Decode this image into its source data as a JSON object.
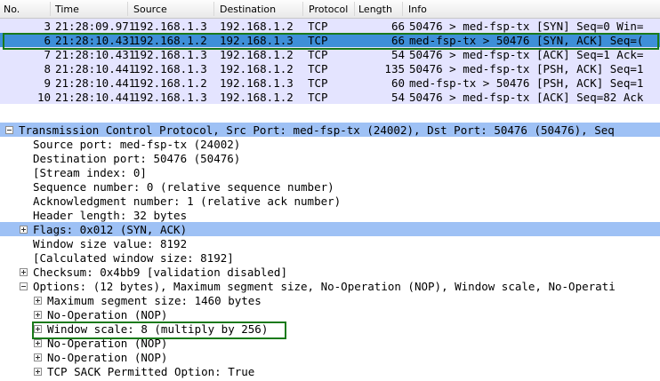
{
  "packet_list": {
    "columns": [
      "No.",
      "Time",
      "Source",
      "Destination",
      "Protocol",
      "Length",
      "Info"
    ],
    "rows": [
      {
        "no": "3",
        "time": "21:28:09.971",
        "src": "192.168.1.3",
        "dst": "192.168.1.2",
        "proto": "TCP",
        "len": "66",
        "info": "50476 > med-fsp-tx [SYN] Seq=0 Win=",
        "selected": false
      },
      {
        "no": "6",
        "time": "21:28:10.431",
        "src": "192.168.1.2",
        "dst": "192.168.1.3",
        "proto": "TCP",
        "len": "66",
        "info": "med-fsp-tx > 50476 [SYN, ACK] Seq=(",
        "selected": true
      },
      {
        "no": "7",
        "time": "21:28:10.431",
        "src": "192.168.1.3",
        "dst": "192.168.1.2",
        "proto": "TCP",
        "len": "54",
        "info": "50476 > med-fsp-tx [ACK] Seq=1 Ack=",
        "selected": false
      },
      {
        "no": "8",
        "time": "21:28:10.441",
        "src": "192.168.1.3",
        "dst": "192.168.1.2",
        "proto": "TCP",
        "len": "135",
        "info": "50476 > med-fsp-tx [PSH, ACK] Seq=1",
        "selected": false
      },
      {
        "no": "9",
        "time": "21:28:10.441",
        "src": "192.168.1.2",
        "dst": "192.168.1.3",
        "proto": "TCP",
        "len": "60",
        "info": "med-fsp-tx > 50476 [PSH, ACK] Seq=1",
        "selected": false
      },
      {
        "no": "10",
        "time": "21:28:10.441",
        "src": "192.168.1.3",
        "dst": "192.168.1.2",
        "proto": "TCP",
        "len": "54",
        "info": "50476 > med-fsp-tx [ACK] Seq=82 Ack",
        "selected": false
      }
    ]
  },
  "details": {
    "rows": [
      {
        "text": "Transmission Control Protocol, Src Port: med-fsp-tx (24002), Dst Port: 50476 (50476), Seq",
        "indent": 0,
        "expander": "minus",
        "band": true,
        "name": "tcp-header-node"
      },
      {
        "text": "Source port: med-fsp-tx (24002)",
        "indent": 1,
        "expander": "none",
        "band": false,
        "name": "source-port-field"
      },
      {
        "text": "Destination port: 50476 (50476)",
        "indent": 1,
        "expander": "none",
        "band": false,
        "name": "destination-port-field"
      },
      {
        "text": "[Stream index: 0]",
        "indent": 1,
        "expander": "none",
        "band": false,
        "name": "stream-index-field"
      },
      {
        "text": "Sequence number: 0    (relative sequence number)",
        "indent": 1,
        "expander": "none",
        "band": false,
        "name": "sequence-number-field"
      },
      {
        "text": "Acknowledgment number: 1    (relative ack number)",
        "indent": 1,
        "expander": "none",
        "band": false,
        "name": "ack-number-field"
      },
      {
        "text": "Header length: 32 bytes",
        "indent": 1,
        "expander": "none",
        "band": false,
        "name": "header-length-field"
      },
      {
        "text": "Flags: 0x012 (SYN, ACK)",
        "indent": 1,
        "expander": "plus",
        "band": true,
        "name": "flags-node"
      },
      {
        "text": "Window size value: 8192",
        "indent": 1,
        "expander": "none",
        "band": false,
        "name": "window-size-value-field"
      },
      {
        "text": "[Calculated window size: 8192]",
        "indent": 1,
        "expander": "none",
        "band": false,
        "name": "calculated-window-size-field"
      },
      {
        "text": "Checksum: 0x4bb9 [validation disabled]",
        "indent": 1,
        "expander": "plus",
        "band": false,
        "name": "checksum-node"
      },
      {
        "text": "Options: (12 bytes), Maximum segment size, No-Operation (NOP), Window scale, No-Operati",
        "indent": 1,
        "expander": "minus",
        "band": false,
        "name": "options-node"
      },
      {
        "text": "Maximum segment size: 1460 bytes",
        "indent": 2,
        "expander": "plus",
        "band": false,
        "name": "option-mss-node"
      },
      {
        "text": "No-Operation (NOP)",
        "indent": 2,
        "expander": "plus",
        "band": false,
        "name": "option-nop-node"
      },
      {
        "text": "Window scale: 8 (multiply by 256)",
        "indent": 2,
        "expander": "plus",
        "band": false,
        "name": "option-window-scale-node"
      },
      {
        "text": "No-Operation (NOP)",
        "indent": 2,
        "expander": "plus",
        "band": false,
        "name": "option-nop-node"
      },
      {
        "text": "No-Operation (NOP)",
        "indent": 2,
        "expander": "plus",
        "band": false,
        "name": "option-nop-node"
      },
      {
        "text": "TCP SACK Permitted Option: True",
        "indent": 2,
        "expander": "plus",
        "band": false,
        "name": "option-sack-permitted-node"
      }
    ]
  },
  "colors": {
    "row_bg": "#e4e4ff",
    "selected_bg": "#3e8fd8",
    "band_bg": "#9ec1f5",
    "highlight_border": "#1a7a1a"
  }
}
